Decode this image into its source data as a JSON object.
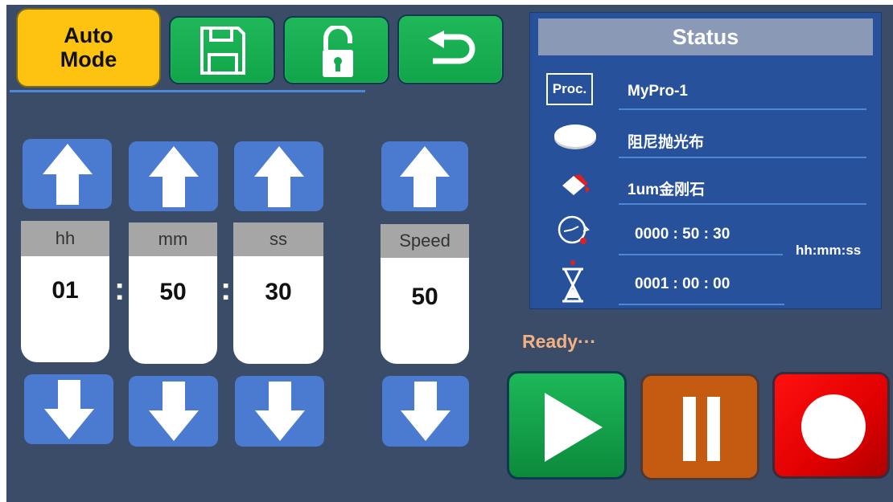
{
  "toolbar": {
    "auto_mode_line1": "Auto",
    "auto_mode_line2": "Mode",
    "icons": [
      "save-icon",
      "unlock-icon",
      "return-icon"
    ]
  },
  "time": {
    "hh_label": "hh",
    "mm_label": "mm",
    "ss_label": "ss",
    "hh_value": "01",
    "mm_value": "50",
    "ss_value": "30",
    "separator": ":"
  },
  "speed": {
    "label": "Speed",
    "value": "50"
  },
  "status": {
    "title": "Status",
    "proc_label": "Proc.",
    "program": "MyPro-1",
    "pad": "阻尼抛光布",
    "abrasive": "1um金刚石",
    "elapsed": "0000 : 50 : 30",
    "total": "0001 : 00 : 00",
    "time_format": "hh:mm:ss"
  },
  "run_state": "Ready···",
  "controls": {
    "icons": [
      "play-icon",
      "pause-icon",
      "stop-icon"
    ]
  },
  "colors": {
    "background": "#3a4c68",
    "auto_mode": "#fec211",
    "green": "#14aa4e",
    "blue_button": "#4a7bd0",
    "status_panel": "#27529b",
    "status_header": "#8a9ab6",
    "ready_text": "#f4b183",
    "pause": "#c55a11",
    "stop": "#ee0000"
  }
}
